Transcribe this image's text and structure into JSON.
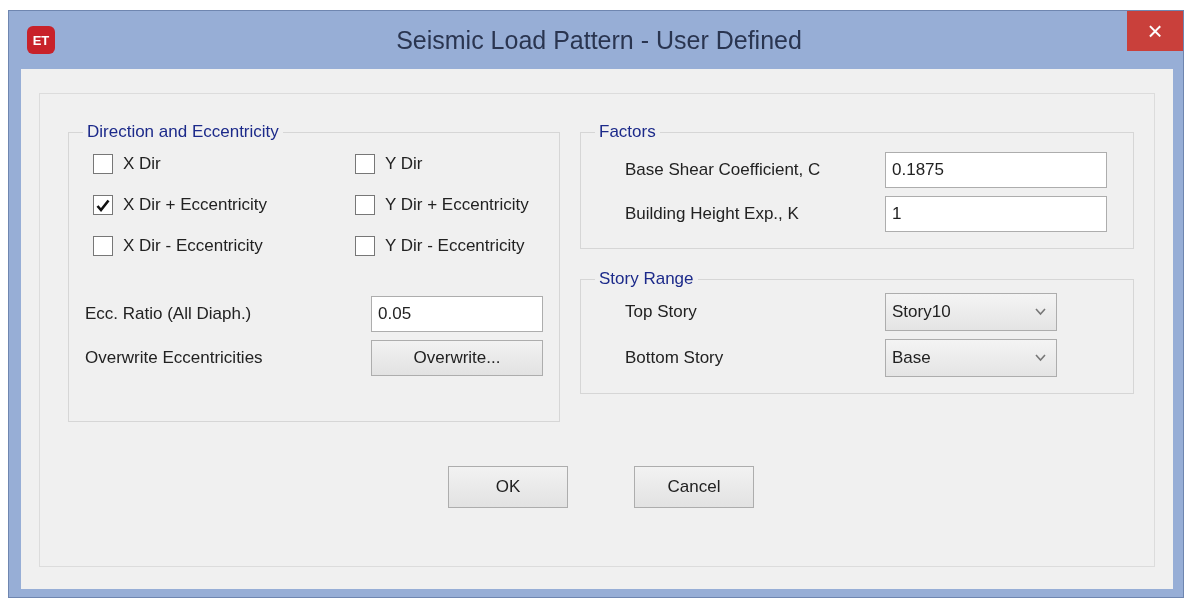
{
  "window": {
    "title": "Seismic Load Pattern - User Defined",
    "app_icon": "ET",
    "close": "×"
  },
  "direction": {
    "title": "Direction and Eccentricity",
    "checkboxes": [
      {
        "label": "X Dir",
        "checked": false
      },
      {
        "label": "Y Dir",
        "checked": false
      },
      {
        "label": "X Dir + Eccentricity",
        "checked": true
      },
      {
        "label": "Y Dir + Eccentricity",
        "checked": false
      },
      {
        "label": "X Dir - Eccentricity",
        "checked": false
      },
      {
        "label": "Y Dir - Eccentricity",
        "checked": false
      }
    ],
    "ecc_ratio": {
      "label": "Ecc. Ratio (All Diaph.)",
      "value": "0.05"
    },
    "overwrite": {
      "label": "Overwrite Eccentricities",
      "button": "Overwrite..."
    }
  },
  "factors": {
    "title": "Factors",
    "fields": [
      {
        "label": "Base Shear Coefficient, C",
        "value": "0.1875"
      },
      {
        "label": "Building Height Exp., K",
        "value": "1"
      }
    ]
  },
  "story_range": {
    "title": "Story Range",
    "dropdowns": [
      {
        "label": "Top Story",
        "value": "Story10"
      },
      {
        "label": "Bottom Story",
        "value": "Base"
      }
    ]
  },
  "buttons": [
    "OK",
    "Cancel"
  ]
}
